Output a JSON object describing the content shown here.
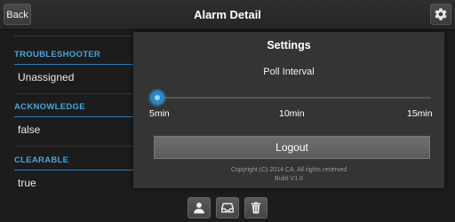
{
  "header": {
    "back_label": "Back",
    "title": "Alarm Detail",
    "settings_icon": "gear-icon"
  },
  "details": {
    "sections": [
      {
        "label": "TROUBLESHOOTER",
        "value": "Unassigned"
      },
      {
        "label": "ACKNOWLEDGE",
        "value": "false"
      },
      {
        "label": "CLEARABLE",
        "value": "true"
      }
    ]
  },
  "settings": {
    "title": "Settings",
    "poll_interval_label": "Poll Interval",
    "poll_interval_value_min": 5,
    "poll_interval_options": [
      "5min",
      "10min",
      "15min"
    ],
    "logout_label": "Logout",
    "copyright": "Copyright (C) 2014 CA. All rights reserved",
    "build": "Build V1.0"
  },
  "toolbar": {
    "icons": [
      "person-icon",
      "inbox-icon",
      "trash-icon"
    ]
  },
  "colors": {
    "accent": "#4aa3d9",
    "slider": "#2f86c0",
    "background": "#1c1c1c",
    "panel": "#343434"
  }
}
